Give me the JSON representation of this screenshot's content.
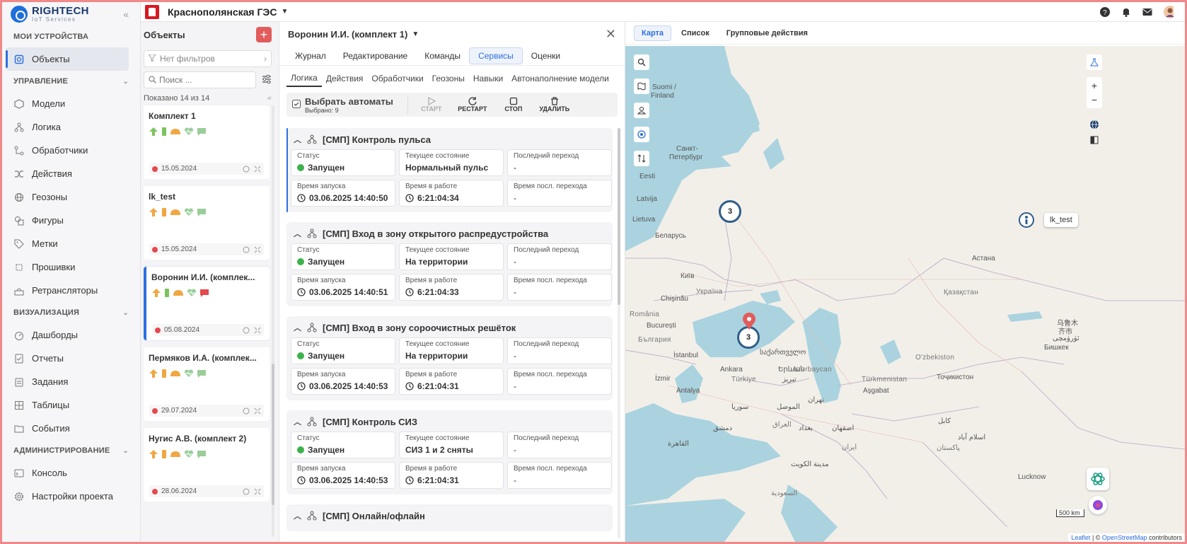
{
  "app": {
    "logo_line1": "RIGHTECH",
    "logo_line2": "IoT Services",
    "project": "Краснополянская ГЭС",
    "colors": {
      "accent": "#2d6fe0",
      "danger": "#e25c5c",
      "ok": "#3db24b",
      "brand": "#d71920"
    }
  },
  "sidebar": {
    "sections": [
      {
        "title": "МОИ УСТРОЙСТВА",
        "items": [
          {
            "label": "Объекты",
            "icon": "cube-icon",
            "active": true
          }
        ]
      },
      {
        "title": "УПРАВЛЕНИЕ",
        "items": [
          {
            "label": "Модели",
            "icon": "model-icon"
          },
          {
            "label": "Логика",
            "icon": "logic-icon"
          },
          {
            "label": "Обработчики",
            "icon": "handler-icon"
          },
          {
            "label": "Действия",
            "icon": "shuffle-icon"
          },
          {
            "label": "Геозоны",
            "icon": "globe-icon"
          },
          {
            "label": "Фигуры",
            "icon": "shapes-icon"
          },
          {
            "label": "Метки",
            "icon": "tag-icon"
          },
          {
            "label": "Прошивки",
            "icon": "firmware-icon"
          },
          {
            "label": "Ретрансляторы",
            "icon": "relay-icon"
          }
        ]
      },
      {
        "title": "ВИЗУАЛИЗАЦИЯ",
        "items": [
          {
            "label": "Дашборды",
            "icon": "dashboard-icon"
          },
          {
            "label": "Отчеты",
            "icon": "report-icon"
          },
          {
            "label": "Задания",
            "icon": "task-icon"
          },
          {
            "label": "Таблицы",
            "icon": "table-icon"
          },
          {
            "label": "События",
            "icon": "event-icon"
          }
        ]
      },
      {
        "title": "АДМИНИСТРИРОВАНИЕ",
        "items": [
          {
            "label": "Консоль",
            "icon": "console-icon"
          },
          {
            "label": "Настройки проекта",
            "icon": "gear-icon"
          }
        ]
      }
    ]
  },
  "objects": {
    "title": "Объекты",
    "filter": "Нет фильтров",
    "search_placeholder": "Поиск ...",
    "shown": "Показано 14 из 14",
    "cards": [
      {
        "name": "Комплект 1",
        "date": "15.05.2024",
        "selected": false
      },
      {
        "name": "lk_test",
        "date": "15.05.2024",
        "selected": false
      },
      {
        "name": "Воронин И.И. (комплек...",
        "date": "05.08.2024",
        "selected": true
      },
      {
        "name": "Пермяков И.А. (комплек...",
        "date": "29.07.2024",
        "selected": false
      },
      {
        "name": "Нугис А.В. (комплект 2)",
        "date": "28.06.2024",
        "selected": false
      }
    ]
  },
  "detail": {
    "title": "Воронин И.И. (комплект 1)",
    "tabs": [
      "Журнал",
      "Редактирование",
      "Команды",
      "Сервисы",
      "Оценки"
    ],
    "active_tab": 3,
    "subtabs": [
      "Логика",
      "Действия",
      "Обработчики",
      "Геозоны",
      "Навыки",
      "Автонаполнение модели"
    ],
    "active_subtab": 0,
    "toolbar": {
      "select_label": "Выбрать автоматы",
      "selected_count": "Выбрано: 9",
      "start": "СТАРТ",
      "restart": "РЕСТАРТ",
      "stop": "СТОП",
      "delete": "УДАЛИТЬ"
    },
    "labels": {
      "status": "Статус",
      "state": "Текущее состояние",
      "last_transition": "Последний переход",
      "start_time": "Время запуска",
      "uptime": "Время в работе",
      "last_time": "Время посл. перехода"
    },
    "rules": [
      {
        "title": "[СМП] Контроль пульса",
        "status": "Запущен",
        "state": "Нормальный пульс",
        "last": "-",
        "start": "03.06.2025 14:40:50",
        "uptime": "6:21:04:34",
        "last_time": "-"
      },
      {
        "title": "[СМП] Вход в зону открытого распредустройства",
        "status": "Запущен",
        "state": "На территории",
        "last": "-",
        "start": "03.06.2025 14:40:51",
        "uptime": "6:21:04:33",
        "last_time": "-"
      },
      {
        "title": "[СМП] Вход в зону сороочистных решёток",
        "status": "Запущен",
        "state": "На территории",
        "last": "-",
        "start": "03.06.2025 14:40:53",
        "uptime": "6:21:04:31",
        "last_time": "-"
      },
      {
        "title": "[СМП] Контроль СИЗ",
        "status": "Запущен",
        "state": "СИЗ 1 и 2 сняты",
        "last": "-",
        "start": "03.06.2025 14:40:53",
        "uptime": "6:21:04:31",
        "last_time": "-"
      },
      {
        "title": "[СМП] Онлайн/офлайн"
      }
    ]
  },
  "map": {
    "tabs": [
      "Карта",
      "Список",
      "Групповые действия"
    ],
    "active_tab": 0,
    "clusters": [
      "3",
      "3"
    ],
    "tooltip": "lk_test",
    "scale": "500 km",
    "attribution_prefix": "Leaflet",
    "attribution_sep": " | © ",
    "attribution_link": "OpenStreetMap",
    "attribution_suffix": " contributors",
    "labels": {
      "suomi": "Suomi /",
      "finland": "Finland",
      "spb1": "Санкт-",
      "spb2": "Петербург",
      "eesti": "Eesti",
      "latvija": "Latvija",
      "lietuva": "Lietuva",
      "belarus": "Беларусь",
      "kyiv": "Київ",
      "ukraina": "Україна",
      "chisinau": "Chişinău",
      "romania": "România",
      "bucuresti": "București",
      "bulgaria": "България",
      "istanbul": "İstanbul",
      "ankara": "Ankara",
      "izmir": "İzmir",
      "turkiye": "Türkiye",
      "antalya": "Antalya",
      "azerbaycan": "Azərbaycan",
      "erevan": "Երևան",
      "georgia": "საქართველო",
      "kazakhstan": "Қазақстан",
      "astana": "Астана",
      "tehran": "تهران",
      "turkmenistan": "Türkmenistan",
      "ashgabat": "Aşgabat",
      "uzbekistan": "O'zbekiston",
      "bishkek": "Бишкек",
      "tajikistan": "Тоҷикистон",
      "kabul": "کابل",
      "islamabad": "اسلام آباد",
      "pakistan": "پاکستان",
      "lucknow": "Lucknow",
      "urumqi1": "乌鲁木",
      "urumqi2": "齐市",
      "urumqi3": "ئۈرۈمچى",
      "iraq": "العراق",
      "mosul": "الموصل",
      "baghdad": "بغداد",
      "syria": "سوريا",
      "damascus": "دمشق",
      "isfahan": "اصفهان",
      "iran": "ایران",
      "cairo": "القاهرة",
      "kuwait": "مدينة الكويت",
      "saudi": "السعودية",
      "tabriz": "تبریز"
    }
  }
}
